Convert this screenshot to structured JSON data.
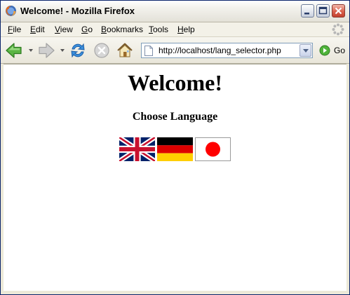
{
  "window": {
    "title": "Welcome! - Mozilla Firefox",
    "controls": [
      "minimize-icon",
      "maximize-icon",
      "close-icon"
    ]
  },
  "menu": {
    "items": [
      {
        "key": "F",
        "rest": "ile"
      },
      {
        "key": "E",
        "rest": "dit"
      },
      {
        "key": "V",
        "rest": "iew"
      },
      {
        "key": "G",
        "rest": "o"
      },
      {
        "key": "B",
        "rest": "ookmarks"
      },
      {
        "key": "T",
        "rest": "ools"
      },
      {
        "key": "H",
        "rest": "elp"
      }
    ]
  },
  "toolbar": {
    "icons": [
      "back-arrow-icon",
      "forward-arrow-icon",
      "reload-icon",
      "stop-icon",
      "home-icon"
    ],
    "url": "http://localhost/lang_selector.php",
    "go_label": "Go"
  },
  "page": {
    "title": "Welcome!",
    "subtitle": "Choose Language",
    "flags": [
      {
        "name": "uk-flag-icon",
        "colors": [
          "#012169",
          "#ffffff",
          "#c8102e"
        ]
      },
      {
        "name": "germany-flag-icon",
        "colors": [
          "#000000",
          "#dd0000",
          "#ffce00"
        ]
      },
      {
        "name": "japan-flag-icon",
        "colors": [
          "#ffffff",
          "#ff0000"
        ]
      }
    ]
  }
}
